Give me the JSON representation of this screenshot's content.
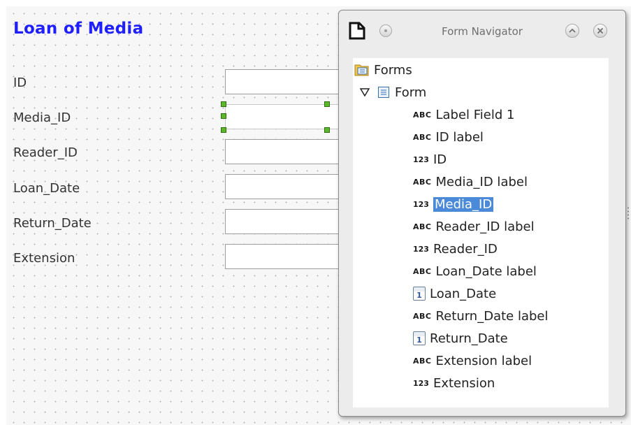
{
  "form": {
    "title": "Loan of Media",
    "fields": [
      {
        "label": "ID"
      },
      {
        "label": "Media_ID"
      },
      {
        "label": "Reader_ID"
      },
      {
        "label": "Loan_Date"
      },
      {
        "label": "Return_Date"
      },
      {
        "label": "Extension"
      }
    ]
  },
  "navigator": {
    "title": "Form Navigator",
    "tree": {
      "root_label": "Forms",
      "form_label": "Form",
      "items": [
        {
          "tag": "ABC",
          "label": "Label Field 1",
          "icon": "label-icon"
        },
        {
          "tag": "ABC",
          "label": "ID label",
          "icon": "label-icon"
        },
        {
          "tag": "123",
          "label": "ID",
          "icon": "numeric-field-icon"
        },
        {
          "tag": "ABC",
          "label": "Media_ID label",
          "icon": "label-icon"
        },
        {
          "tag": "123",
          "label": "Media_ID",
          "icon": "numeric-field-icon",
          "selected": true
        },
        {
          "tag": "ABC",
          "label": "Reader_ID label",
          "icon": "label-icon"
        },
        {
          "tag": "123",
          "label": "Reader_ID",
          "icon": "numeric-field-icon"
        },
        {
          "tag": "ABC",
          "label": "Loan_Date label",
          "icon": "label-icon"
        },
        {
          "tag": "1",
          "label": "Loan_Date",
          "icon": "date-field-icon"
        },
        {
          "tag": "ABC",
          "label": "Return_Date label",
          "icon": "label-icon"
        },
        {
          "tag": "1",
          "label": "Return_Date",
          "icon": "date-field-icon"
        },
        {
          "tag": "ABC",
          "label": "Extension label",
          "icon": "label-icon"
        },
        {
          "tag": "123",
          "label": "Extension",
          "icon": "numeric-field-icon"
        }
      ]
    }
  },
  "colors": {
    "title": "#1f1fff",
    "selection": "#4a8ad8",
    "handle": "#5cb82a"
  }
}
